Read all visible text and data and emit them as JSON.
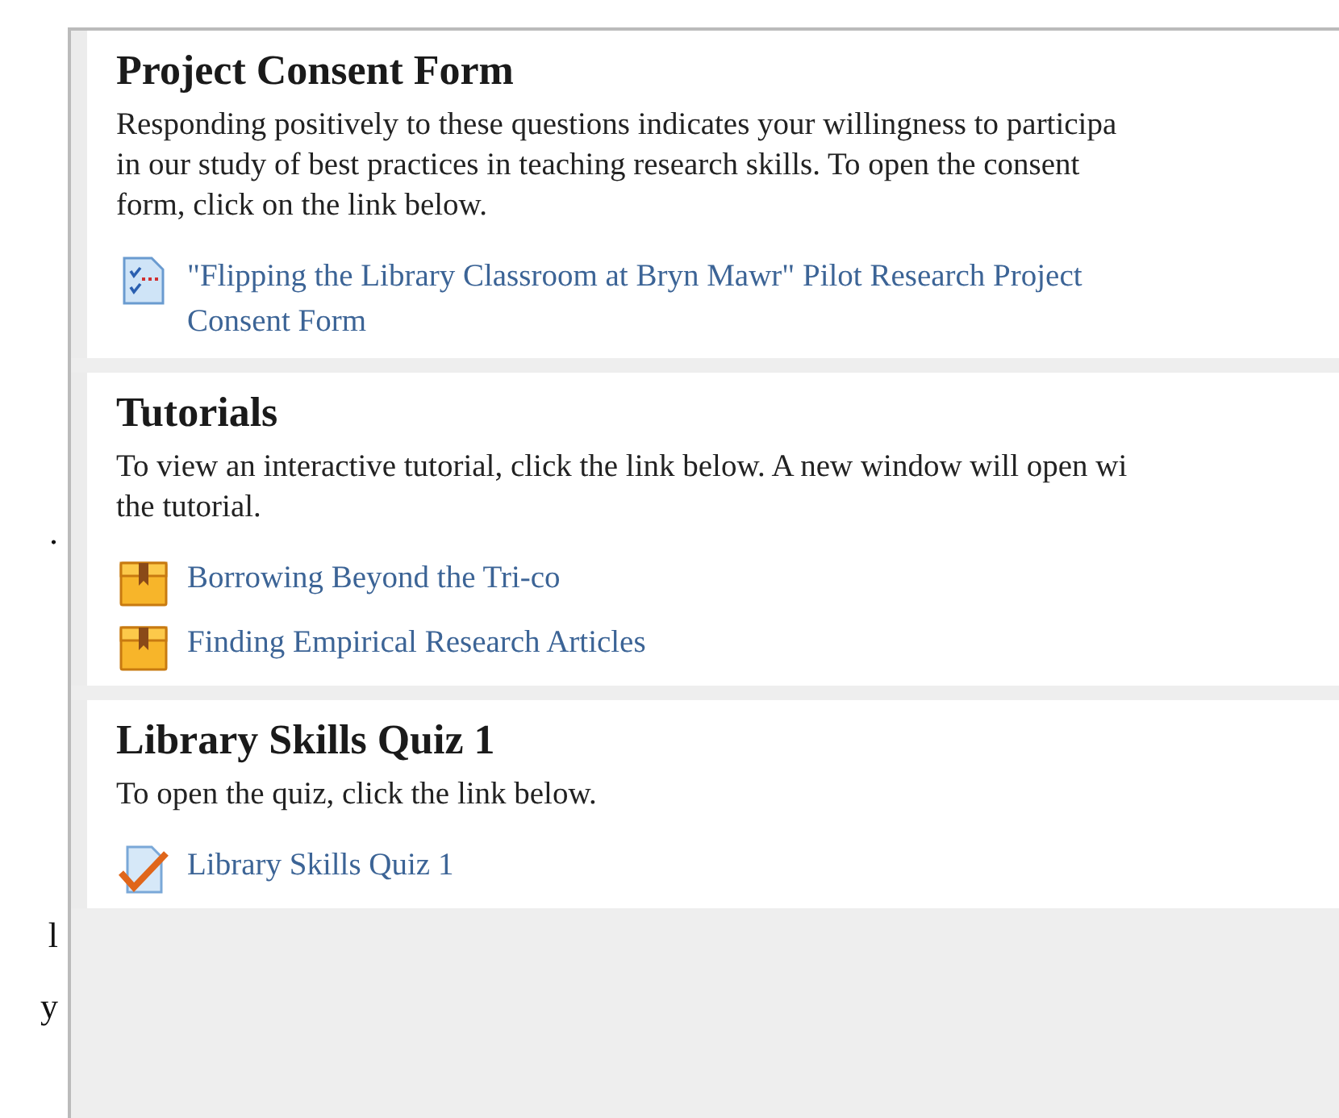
{
  "left_margin_fragments": [
    ".",
    "l",
    "y"
  ],
  "sections": [
    {
      "title": "Project Consent Form",
      "text": "Responding positively to these questions indicates your willingness to participa\nin our study of best practices in teaching research skills.  To open the consent\nform, click on the link below.",
      "links": [
        {
          "kind": "survey",
          "label": "\"Flipping the Library Classroom at Bryn Mawr\" Pilot Research Project\nConsent Form"
        }
      ]
    },
    {
      "title": "Tutorials",
      "text": "To view an interactive tutorial, click the link below.  A new window will open wi\nthe tutorial.",
      "links": [
        {
          "kind": "package",
          "label": "Borrowing Beyond the Tri-co"
        },
        {
          "kind": "package",
          "label": "Finding Empirical Research Articles"
        }
      ]
    },
    {
      "title": "Library Skills Quiz 1",
      "text": "To open the quiz, click the link below.",
      "links": [
        {
          "kind": "quiz",
          "label": "Library Skills Quiz 1"
        }
      ]
    }
  ]
}
